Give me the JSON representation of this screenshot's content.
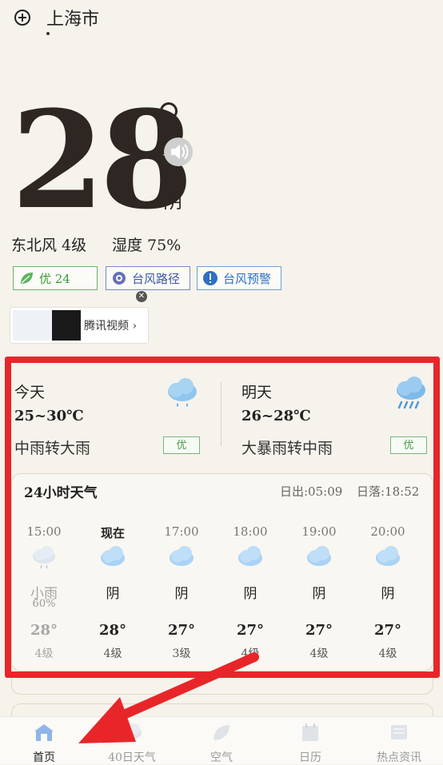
{
  "header": {
    "city": "上海市",
    "add_icon": "plus-circle-icon"
  },
  "current": {
    "temperature": "28",
    "condition": "阴",
    "wind": "东北风 4级",
    "humidity": "湿度 75%"
  },
  "chips": {
    "aqi": "优 24",
    "typhoon_path": "台风路径",
    "typhoon_alert": "台风预警"
  },
  "ad": {
    "label": "腾讯视频 ›"
  },
  "today": {
    "title": "今天",
    "range": "25~30℃",
    "condition": "中雨转大雨",
    "aqi": "优"
  },
  "tomorrow": {
    "title": "明天",
    "range": "26~28℃",
    "condition": "大暴雨转中雨",
    "aqi": "优"
  },
  "hourly": {
    "title": "24小时天气",
    "sunrise": "日出:05:09",
    "sunset": "日落:18:52",
    "items": [
      {
        "time": "15:00",
        "cond": "小雨",
        "pop": "60%",
        "temp": "28°",
        "wind": "4级"
      },
      {
        "time": "现在",
        "cond": "阴",
        "pop": "",
        "temp": "28°",
        "wind": "4级"
      },
      {
        "time": "17:00",
        "cond": "阴",
        "pop": "",
        "temp": "27°",
        "wind": "3级"
      },
      {
        "time": "18:00",
        "cond": "阴",
        "pop": "",
        "temp": "27°",
        "wind": "4级"
      },
      {
        "time": "19:00",
        "cond": "阴",
        "pop": "",
        "temp": "27°",
        "wind": "4级"
      },
      {
        "time": "20:00",
        "cond": "阴",
        "pop": "",
        "temp": "27°",
        "wind": "4级"
      }
    ]
  },
  "nav": {
    "items": [
      {
        "label": "首页"
      },
      {
        "label": "40日天气"
      },
      {
        "label": "空气"
      },
      {
        "label": "日历"
      },
      {
        "label": "热点资讯"
      }
    ]
  },
  "colors": {
    "highlight": "#e8262a",
    "accent_green": "#3a9a3a",
    "accent_blue": "#2e6fc2"
  }
}
